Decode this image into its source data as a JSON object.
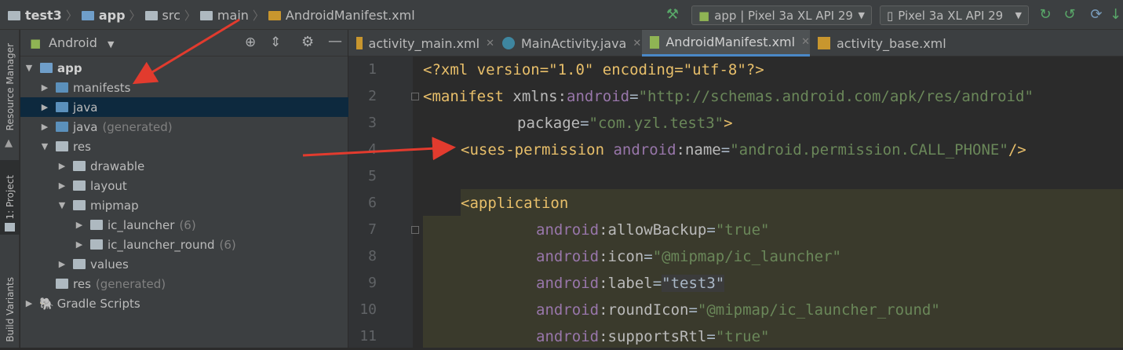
{
  "breadcrumb": {
    "items": [
      "test3",
      "app",
      "src",
      "main",
      "AndroidManifest.xml"
    ]
  },
  "toolbar": {
    "run_config": "app | Pixel 3a XL API 29",
    "device": "Pixel 3a XL API 29"
  },
  "side_tabs": {
    "resource_manager": "Resource Manager",
    "project": "1: Project",
    "build_variants": "Build Variants"
  },
  "project_panel": {
    "view_mode": "Android",
    "tree": [
      {
        "label": "app",
        "bold": true
      },
      {
        "label": "manifests"
      },
      {
        "label": "java"
      },
      {
        "label": "java",
        "suffix": "(generated)"
      },
      {
        "label": "res"
      },
      {
        "label": "drawable"
      },
      {
        "label": "layout"
      },
      {
        "label": "mipmap"
      },
      {
        "label": "ic_launcher",
        "suffix": "(6)"
      },
      {
        "label": "ic_launcher_round",
        "suffix": "(6)"
      },
      {
        "label": "values"
      },
      {
        "label": "res",
        "suffix": "(generated)"
      },
      {
        "label": "Gradle Scripts"
      }
    ]
  },
  "editor": {
    "tabs": [
      "activity_main.xml",
      "MainActivity.java",
      "AndroidManifest.xml",
      "activity_base.xml"
    ],
    "active_tab": "AndroidManifest.xml",
    "line_numbers": [
      "1",
      "2",
      "3",
      "4",
      "5",
      "6",
      "7",
      "8",
      "9",
      "10",
      "11"
    ],
    "lines": [
      [
        "<?xml version=\"1.0\" encoding=\"utf-8\"?>"
      ],
      [
        "<manifest",
        " xmlns:",
        "android",
        "=",
        "\"http://schemas.android.com/apk/res/android\""
      ],
      [
        "package",
        "=",
        "\"com.yzl.test3\"",
        ">"
      ],
      [
        "<uses-permission",
        " android",
        ":name",
        "=",
        "\"android.permission.CALL_PHONE\"",
        "/>"
      ],
      [
        ""
      ],
      [
        "<application"
      ],
      [
        "android",
        ":allowBackup",
        "=",
        "\"true\""
      ],
      [
        "android",
        ":icon",
        "=",
        "\"@mipmap/ic_launcher\""
      ],
      [
        "android",
        ":label",
        "=",
        "\"test3\""
      ],
      [
        "android",
        ":roundIcon",
        "=",
        "\"@mipmap/ic_launcher_round\""
      ],
      [
        "android",
        ":supportsRtl",
        "=",
        "\"true\""
      ]
    ]
  },
  "colors": {
    "arrow": "#e23b2e",
    "tag": "#e8bf6a",
    "string": "#6a8759",
    "namespace": "#9876aa",
    "selection": "#0d293e"
  }
}
